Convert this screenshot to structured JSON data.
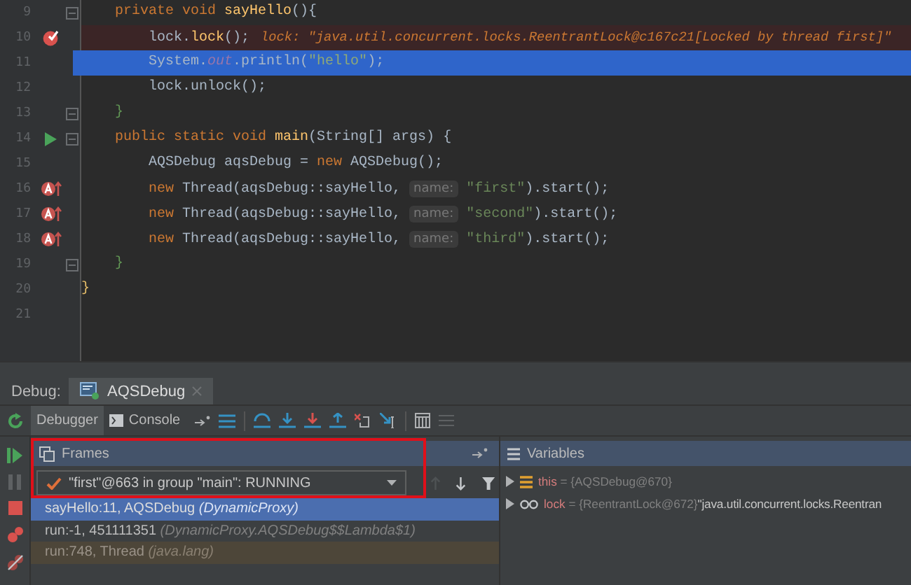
{
  "editor": {
    "lines": [
      {
        "number": "9",
        "kind": "plain",
        "fold": true,
        "current": false,
        "tokens": [
          {
            "t": "    private void ",
            "kind": "keyword"
          },
          {
            "t": "sayHello",
            "kind": "method"
          },
          {
            "t": "(){",
            "kind": "plain"
          }
        ]
      },
      {
        "number": "10",
        "kind": "breakpoint",
        "fold": false,
        "current": false,
        "tokens": [
          {
            "t": "        lock.",
            "kind": "plain"
          },
          {
            "t": "lock",
            "kind": "method"
          },
          {
            "t": "();",
            "kind": "plain"
          },
          {
            "t": "lock: \"java.util.concurrent.locks.ReentrantLock@c167c21[Locked by thread first]\"",
            "kind": "inline-value"
          }
        ]
      },
      {
        "number": "11",
        "kind": "plain",
        "fold": false,
        "current": true,
        "tokens": [
          {
            "t": "        System.",
            "kind": "plain"
          },
          {
            "t": "out",
            "kind": "static-field"
          },
          {
            "t": ".println(",
            "kind": "plain"
          },
          {
            "t": "\"hello\"",
            "kind": "string"
          },
          {
            "t": ");",
            "kind": "plain"
          }
        ]
      },
      {
        "number": "12",
        "kind": "plain",
        "fold": false,
        "current": false,
        "tokens": [
          {
            "t": "        lock.unlock();",
            "kind": "plain"
          }
        ]
      },
      {
        "number": "13",
        "kind": "plain",
        "fold": true,
        "current": false,
        "tokens": [
          {
            "t": "    }",
            "kind": "brace"
          }
        ]
      },
      {
        "number": "14",
        "kind": "run",
        "fold": true,
        "current": false,
        "tokens": [
          {
            "t": "    public static void ",
            "kind": "keyword"
          },
          {
            "t": "main",
            "kind": "method"
          },
          {
            "t": "(String[] args) {",
            "kind": "plain"
          }
        ]
      },
      {
        "number": "15",
        "kind": "plain",
        "fold": false,
        "current": false,
        "tokens": [
          {
            "t": "        AQSDebug aqsDebug = ",
            "kind": "plain"
          },
          {
            "t": "new ",
            "kind": "keyword"
          },
          {
            "t": "AQSDebug();",
            "kind": "plain"
          }
        ]
      },
      {
        "number": "16",
        "kind": "override",
        "fold": false,
        "current": false,
        "tokens": [
          {
            "t": "        new ",
            "kind": "keyword"
          },
          {
            "t": "Thread(aqsDebug::sayHello, ",
            "kind": "plain"
          },
          {
            "t": "name:",
            "kind": "param-hint"
          },
          {
            "t": " \"first\"",
            "kind": "string"
          },
          {
            "t": ").start();",
            "kind": "plain"
          }
        ]
      },
      {
        "number": "17",
        "kind": "override",
        "fold": false,
        "current": false,
        "tokens": [
          {
            "t": "        new ",
            "kind": "keyword"
          },
          {
            "t": "Thread(aqsDebug::sayHello, ",
            "kind": "plain"
          },
          {
            "t": "name:",
            "kind": "param-hint"
          },
          {
            "t": " \"second\"",
            "kind": "string"
          },
          {
            "t": ").start();",
            "kind": "plain"
          }
        ]
      },
      {
        "number": "18",
        "kind": "override",
        "fold": false,
        "current": false,
        "tokens": [
          {
            "t": "        new ",
            "kind": "keyword"
          },
          {
            "t": "Thread(aqsDebug::sayHello, ",
            "kind": "plain"
          },
          {
            "t": "name:",
            "kind": "param-hint"
          },
          {
            "t": " \"third\"",
            "kind": "string"
          },
          {
            "t": ").start();",
            "kind": "plain"
          }
        ]
      },
      {
        "number": "19",
        "kind": "plain",
        "fold": true,
        "current": false,
        "tokens": [
          {
            "t": "    }",
            "kind": "brace"
          }
        ]
      },
      {
        "number": "20",
        "kind": "plain",
        "fold": false,
        "current": false,
        "tokens": [
          {
            "t": "}",
            "kind": "outer-brace"
          }
        ]
      },
      {
        "number": "21",
        "kind": "plain",
        "fold": false,
        "current": false
      }
    ]
  },
  "debug": {
    "label": "Debug:",
    "session_tab": "AQSDebug",
    "tabs": [
      {
        "label": "Debugger",
        "selected": true
      },
      {
        "label": "Console",
        "selected": false
      }
    ],
    "frames": {
      "title": "Frames",
      "thread": "\"first\"@663 in group \"main\": RUNNING",
      "items": [
        {
          "method": "sayHello:11, AQSDebug",
          "detail": "(DynamicProxy)",
          "selected": true,
          "library": false
        },
        {
          "method": "run:-1, 451111351",
          "detail": "(DynamicProxy.AQSDebug$$Lambda$1)",
          "selected": false,
          "library": false
        },
        {
          "method": "run:748, Thread",
          "detail": "(java.lang)",
          "selected": false,
          "library": true
        }
      ]
    },
    "variables": {
      "title": "Variables",
      "items": [
        {
          "kind": "field",
          "name": "this",
          "value": "= {AQSDebug@670}"
        },
        {
          "kind": "watch",
          "name": "lock",
          "value": "= {ReentrantLock@672}",
          "extra": "\"java.util.concurrent.locks.Reentran"
        }
      ]
    }
  }
}
